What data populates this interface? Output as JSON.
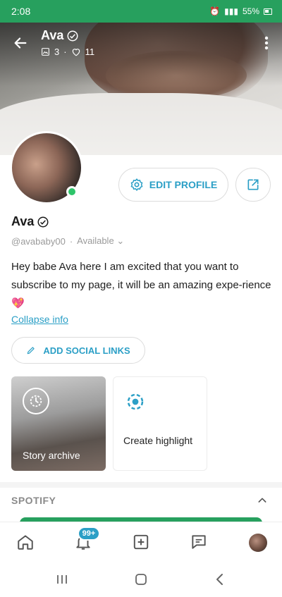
{
  "status_bar": {
    "time": "2:08",
    "battery": "55%"
  },
  "header": {
    "name": "Ava",
    "photos_count": "3",
    "likes_count": "11"
  },
  "profile": {
    "name": "Ava",
    "handle": "@avababy00",
    "availability": "Available",
    "bio": "Hey babe Ava here I am excited that you want to subscribe to my page, it will be an amazing expe-rience 💖",
    "collapse_label": "Collapse info"
  },
  "actions": {
    "edit_profile": "EDIT PROFILE",
    "add_social_links": "ADD SOCIAL LINKS"
  },
  "highlights": {
    "story_archive": "Story archive",
    "create_highlight": "Create highlight"
  },
  "sections": {
    "spotify": "SPOTIFY"
  },
  "bottom_nav": {
    "notifications_badge": "99+"
  },
  "colors": {
    "accent": "#2b9fc6",
    "status_green": "#27a05e",
    "online": "#2ec46a"
  }
}
